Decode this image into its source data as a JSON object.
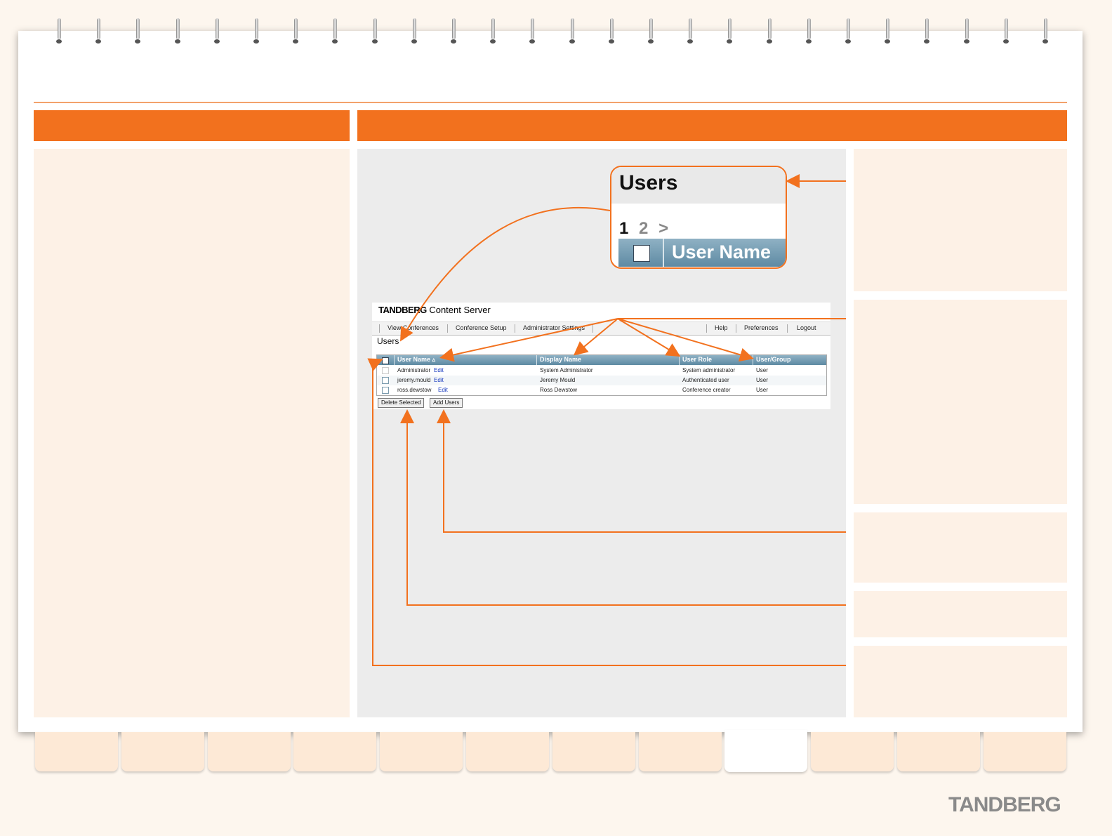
{
  "zoom_callout": {
    "title": "Users",
    "pages": [
      "1",
      "2",
      ">"
    ],
    "column_label": "User Name"
  },
  "app": {
    "brand_bold": "TANDBERG",
    "brand_rest": "Content Server",
    "nav_left": [
      "View Conferences",
      "Conference Setup",
      "Administrator Settings"
    ],
    "nav_right": [
      "Help",
      "Preferences",
      "Logout"
    ],
    "page_title": "Users",
    "table": {
      "columns": [
        "User Name",
        "Display Name",
        "User Role",
        "User/Group"
      ],
      "sort_indicator": "▵",
      "rows": [
        {
          "user_name": "Administrator",
          "edit": "Edit",
          "display_name": "System Administrator",
          "role": "System administrator",
          "group": "User"
        },
        {
          "user_name": "jeremy.mould",
          "edit": "Edit",
          "display_name": "Jeremy Mould",
          "role": "Authenticated user",
          "group": "User"
        },
        {
          "user_name": "ross.dewstow",
          "edit": "Edit",
          "display_name": "Ross Dewstow",
          "role": "Conference creator",
          "group": "User"
        }
      ]
    },
    "buttons": {
      "delete_selected": "Delete Selected",
      "add_users": "Add Users"
    }
  },
  "footer_logo": "TANDBERG",
  "colors": {
    "accent": "#f2711e",
    "panel": "#fdf1e6",
    "gray_panel": "#ececec",
    "table_header": "#6f97ad"
  }
}
